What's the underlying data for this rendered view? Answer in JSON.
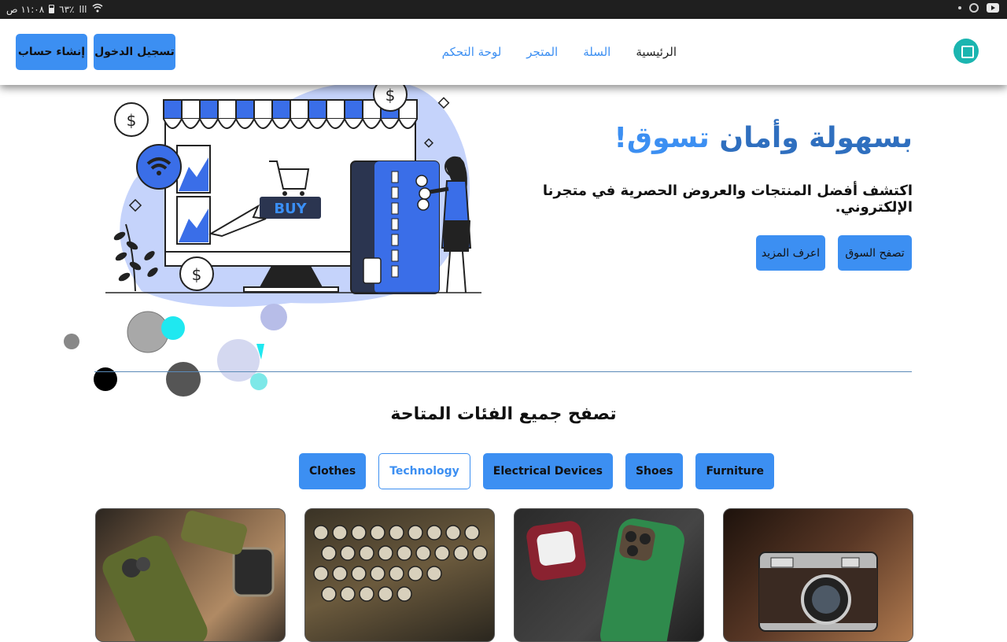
{
  "status_bar": {
    "time": "١١:٠٨ ص",
    "battery": "٦٣٪",
    "signal": "ااا"
  },
  "nav": {
    "logo_name": "store-logo",
    "links": [
      {
        "label": "الرئيسية",
        "active": true
      },
      {
        "label": "السلة",
        "active": false
      },
      {
        "label": "المتجر",
        "active": false
      },
      {
        "label": "لوحة التحكم",
        "active": false
      }
    ],
    "login_label": "تسجيل الدخول",
    "signup_label": "إنشاء حساب"
  },
  "hero": {
    "title_w1": "تسوق",
    "title_w2": "بسهولة وأمان",
    "title_w3": "!",
    "subtitle": "اكتشف أفضل المنتجات والعروض الحصرية في متجرنا الإلكتروني.",
    "browse_label": "تصفح السوق",
    "more_label": "اعرف المزيد",
    "illustration_buy_text": "BUY"
  },
  "categories": {
    "heading": "تصفح جميع الفئات المتاحة",
    "items": [
      {
        "label": "Clothes",
        "active": false
      },
      {
        "label": "Technology",
        "active": true
      },
      {
        "label": "Electrical Devices",
        "active": false
      },
      {
        "label": "Shoes",
        "active": false
      },
      {
        "label": "Furniture",
        "active": false
      }
    ]
  },
  "products": [
    {
      "name": "phone-case-and-watch"
    },
    {
      "name": "vintage-keyboard"
    },
    {
      "name": "green-phone-and-earbuds"
    },
    {
      "name": "vintage-camera"
    }
  ],
  "colors": {
    "accent": "#3c8ff2",
    "status_bar": "#1f1f1f",
    "illustration_blob": "#c5d3fb"
  }
}
